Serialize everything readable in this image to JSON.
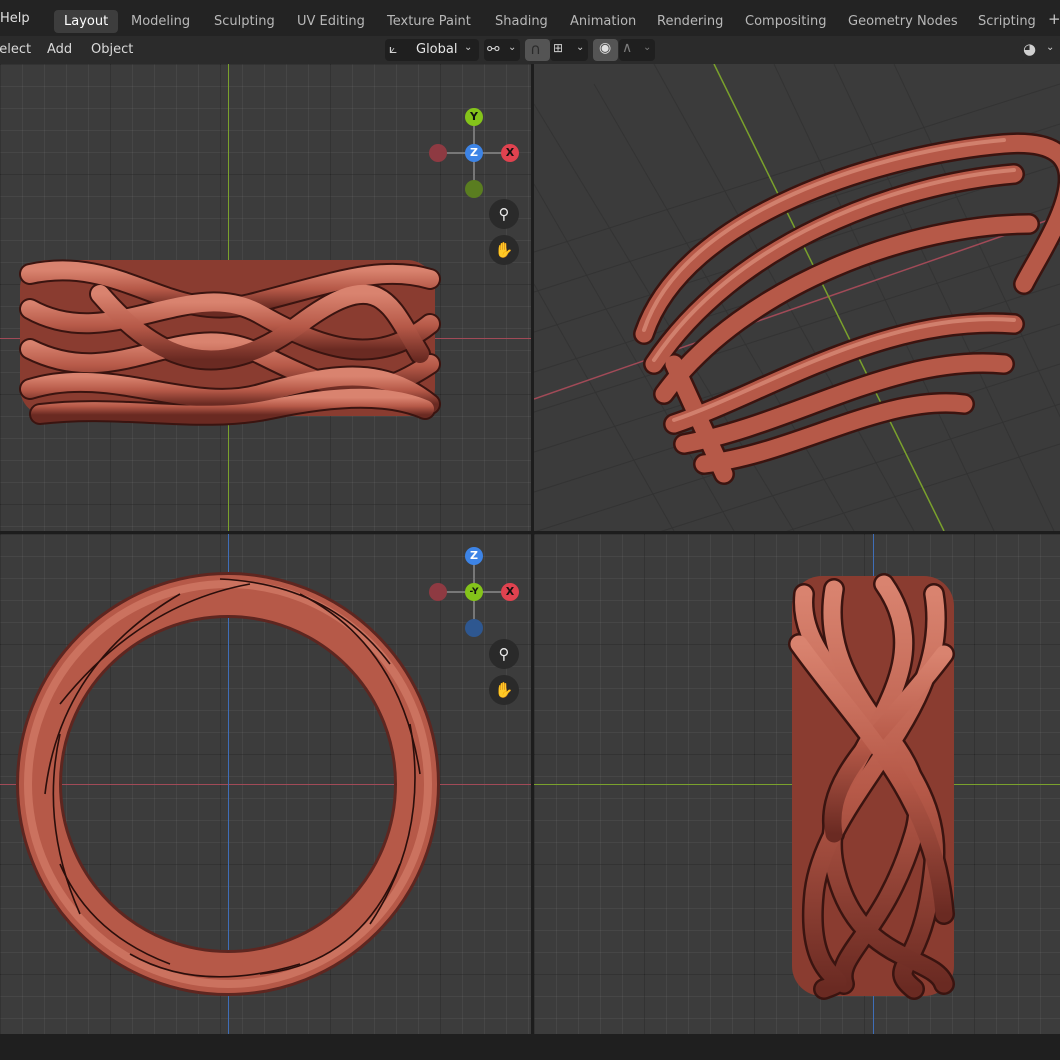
{
  "menubar": {
    "help": "Help"
  },
  "workspace_tabs": [
    {
      "label": "Layout",
      "active": true
    },
    {
      "label": "Modeling"
    },
    {
      "label": "Sculpting"
    },
    {
      "label": "UV Editing"
    },
    {
      "label": "Texture Paint"
    },
    {
      "label": "Shading"
    },
    {
      "label": "Animation"
    },
    {
      "label": "Rendering"
    },
    {
      "label": "Compositing"
    },
    {
      "label": "Geometry Nodes"
    },
    {
      "label": "Scripting"
    }
  ],
  "header": {
    "select_label": "Select",
    "add_label": "Add",
    "object_label": "Object",
    "transform_orientation": "Global"
  },
  "icons": {
    "add_workspace": "+",
    "transform_orientation": "orientation-icon",
    "pivot": "pivot-icon",
    "snap": "magnet-icon",
    "snap_target": "snap-increment-icon",
    "proportional": "proportional-editing-icon",
    "falloff": "falloff-curve-icon",
    "visibility": "eye-icon",
    "zoom": "zoom-icon",
    "pan": "hand-icon"
  },
  "viewports": [
    {
      "id": "front",
      "gizmo": {
        "up": "Y",
        "center": "Z",
        "right": "X"
      }
    },
    {
      "id": "perspective"
    },
    {
      "id": "top",
      "gizmo": {
        "up": "Z",
        "center": "-Y",
        "right": "X"
      }
    },
    {
      "id": "side"
    }
  ],
  "colors": {
    "axis_x": "#e0424f",
    "axis_y": "#84c41a",
    "axis_z": "#3d84e6",
    "ring": "#b75a4b",
    "ring_dark": "#6a2a22",
    "ui_bg": "#2b2b2b",
    "viewport_bg": "#3c3c3c"
  }
}
